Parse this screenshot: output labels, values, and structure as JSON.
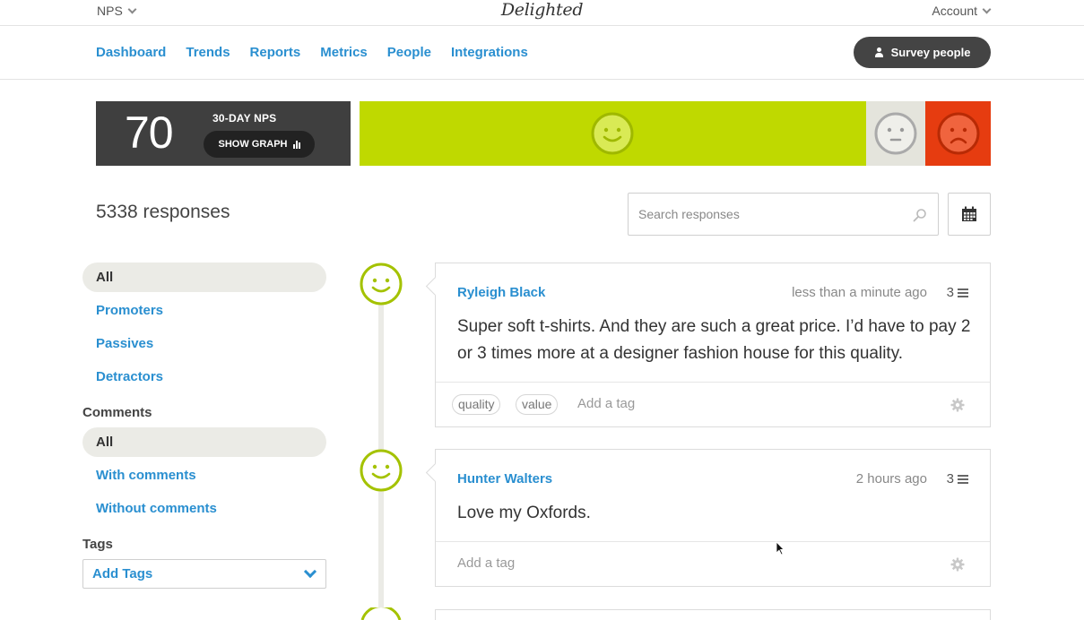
{
  "topbar": {
    "survey_type": "NPS",
    "logo": "Delighted",
    "account_label": "Account"
  },
  "nav": {
    "links": [
      "Dashboard",
      "Trends",
      "Reports",
      "Metrics",
      "People",
      "Integrations"
    ],
    "survey_button": "Survey people"
  },
  "nps": {
    "score": "70",
    "label": "30-DAY NPS",
    "show_graph": "SHOW GRAPH",
    "distribution": {
      "promoters_fraction": 0.802,
      "passives_fraction": 0.095,
      "detractors_fraction": 0.103
    },
    "colors": {
      "promoter": "#bfd900",
      "passive": "#e4e4dc",
      "detractor": "#e63c10"
    }
  },
  "responses": {
    "count_label": "5338 responses",
    "search_placeholder": "Search responses"
  },
  "sidebar": {
    "filters": [
      "All",
      "Promoters",
      "Passives",
      "Detractors"
    ],
    "comments_heading": "Comments",
    "comment_filters": [
      "All",
      "With comments",
      "Without comments"
    ],
    "tags_heading": "Tags",
    "add_tags": "Add Tags"
  },
  "cards": [
    {
      "name": "Ryleigh Black",
      "time": "less than a minute ago",
      "score": "3",
      "comment": "Super soft t-shirts. And they are such a great price. I’d have to pay 2 or 3 times more at a designer fashion house for this quality.",
      "tags": [
        "quality",
        "value"
      ],
      "add_tag": "Add a tag"
    },
    {
      "name": "Hunter Walters",
      "time": "2 hours ago",
      "score": "3",
      "comment": "Love my Oxfords.",
      "tags": [],
      "add_tag": "Add a tag"
    }
  ]
}
